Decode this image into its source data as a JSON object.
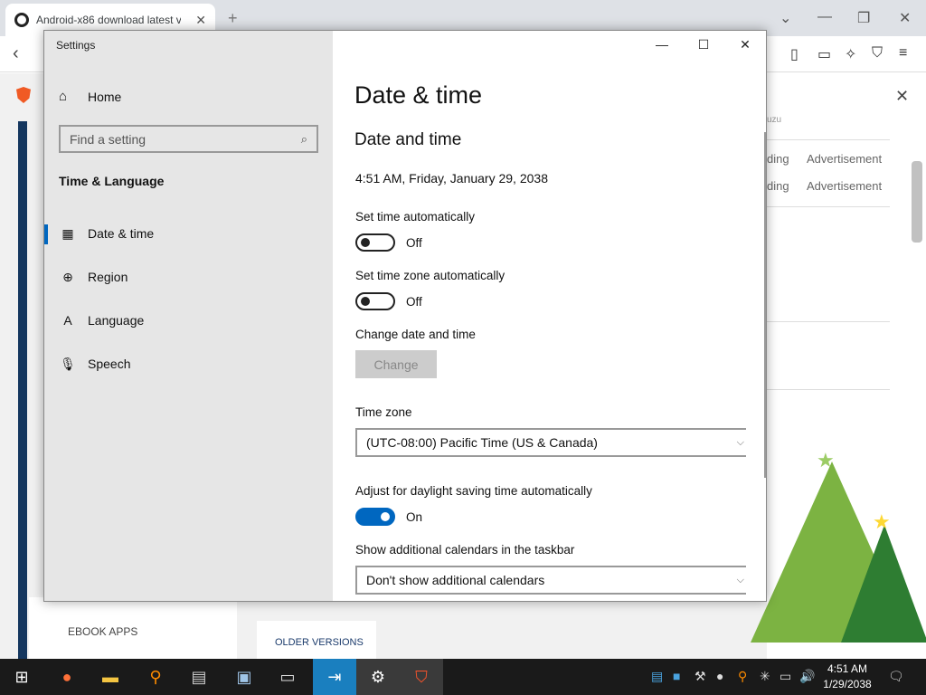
{
  "browser": {
    "tab_title": "Android-x86 download latest v",
    "tab_close": "✕",
    "new_tab": "+"
  },
  "page": {
    "rows": [
      "ding",
      "Advertisement",
      "ding",
      "Advertisement"
    ],
    "top_label": "uzu",
    "ebook_apps": "EBOOK APPS",
    "older_versions": "OLDER VERSIONS"
  },
  "settings": {
    "window_title": "Settings",
    "home_label": "Home",
    "search_placeholder": "Find a setting",
    "section_header": "Time & Language",
    "nav": [
      {
        "label": "Date & time",
        "icon": "calendar-clock-icon"
      },
      {
        "label": "Region",
        "icon": "globe-icon"
      },
      {
        "label": "Language",
        "icon": "language-icon"
      },
      {
        "label": "Speech",
        "icon": "microphone-icon"
      }
    ],
    "page_heading": "Date & time",
    "sub_heading": "Date and time",
    "current_time": "4:51 AM, Friday, January 29, 2038",
    "set_time_auto": {
      "label": "Set time automatically",
      "state": "Off"
    },
    "set_tz_auto": {
      "label": "Set time zone automatically",
      "state": "Off"
    },
    "change_date": {
      "label": "Change date and time",
      "button": "Change"
    },
    "time_zone": {
      "label": "Time zone",
      "value": "(UTC-08:00) Pacific Time (US & Canada)"
    },
    "dst": {
      "label": "Adjust for daylight saving time automatically",
      "state": "On"
    },
    "calendars": {
      "label": "Show additional calendars in the taskbar",
      "value": "Don't show additional calendars"
    }
  },
  "taskbar": {
    "time": "4:51 AM",
    "date": "1/29/2038"
  },
  "colors": {
    "accent": "#0067c0",
    "sidebar": "#e6e6e6",
    "taskbar": "#1a1a1a"
  }
}
